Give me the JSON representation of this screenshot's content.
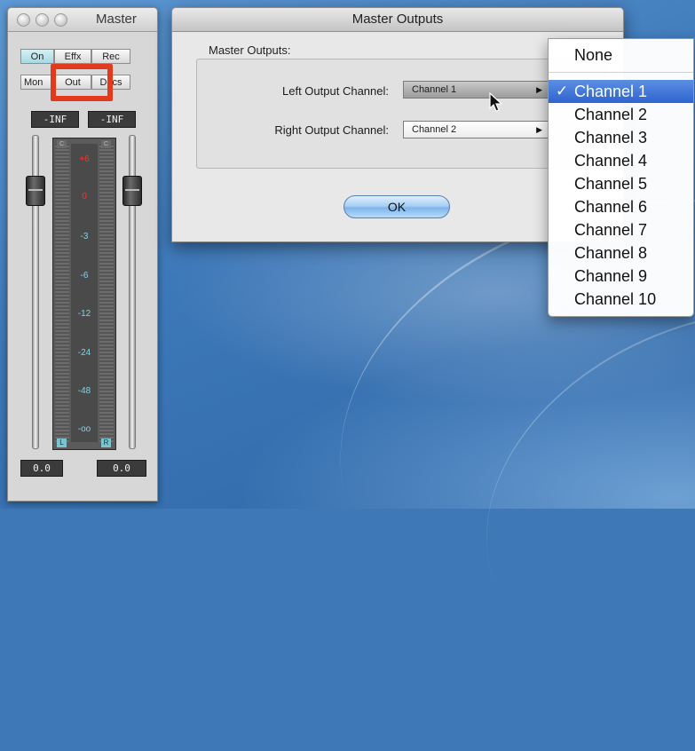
{
  "mixer": {
    "title": "Master",
    "buttons_row1": [
      "On",
      "Effx",
      "Rec"
    ],
    "buttons_row2": [
      "Mon",
      "Out",
      "Docs"
    ],
    "peak_left": "-INF",
    "peak_right": "-INF",
    "scale": [
      "+6",
      "0",
      "-3",
      "-6",
      "-12",
      "-24",
      "-48",
      "-oo"
    ],
    "channel_left": "L",
    "channel_right": "R",
    "clip_left": "C",
    "clip_right": "C",
    "fader_left_value": "0.0",
    "fader_right_value": "0.0"
  },
  "dialog": {
    "title": "Master Outputs",
    "group_label": "Master Outputs:",
    "left_label": "Left Output Channel:",
    "left_value": "Channel 1",
    "right_label": "Right Output Channel:",
    "right_value": "Channel 2",
    "ok_label": "OK"
  },
  "menu": {
    "none_label": "None",
    "check": "✓",
    "selected_index": 0,
    "items": [
      "Channel 1",
      "Channel 2",
      "Channel 3",
      "Channel 4",
      "Channel 5",
      "Channel 6",
      "Channel 7",
      "Channel 8",
      "Channel 9",
      "Channel 10"
    ]
  },
  "colors": {
    "highlight_red": "#e23a1c",
    "menu_selection": "#3b70d6",
    "scale_red": "#ff3030",
    "scale_blue": "#7fd6e6"
  },
  "icons": [
    "close-traffic-light-icon",
    "minimize-traffic-light-icon",
    "zoom-traffic-light-icon",
    "popup-arrow-icon",
    "checkmark-icon",
    "mouse-pointer-icon"
  ]
}
